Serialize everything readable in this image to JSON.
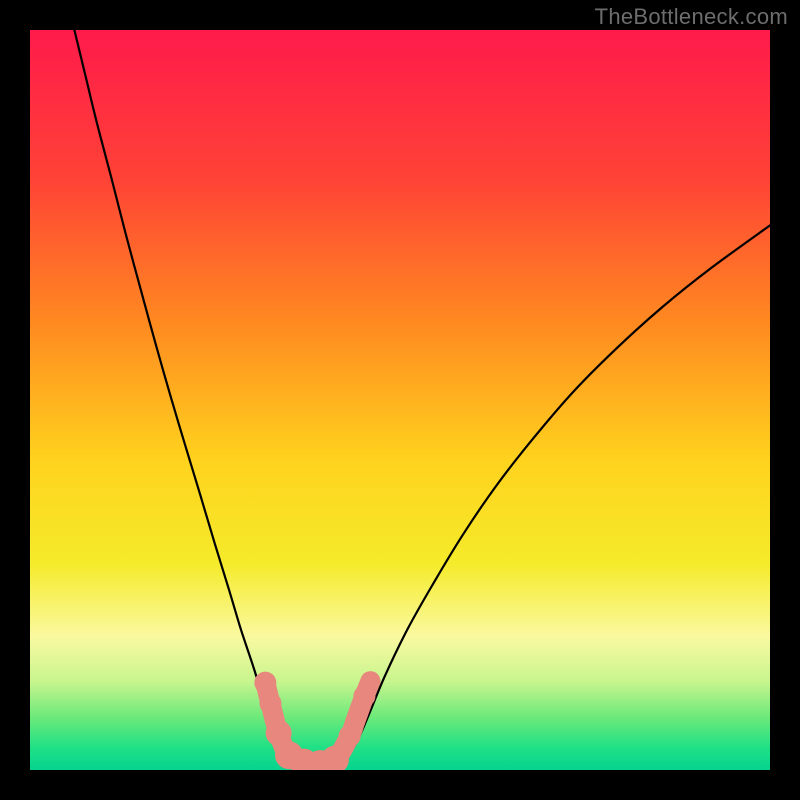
{
  "watermark": "TheBottleneck.com",
  "chart_data": {
    "type": "line",
    "title": "",
    "xlabel": "",
    "ylabel": "",
    "xlim": [
      0,
      1
    ],
    "ylim": [
      0,
      1
    ],
    "background_gradient": {
      "stops": [
        {
          "offset": 0.0,
          "color": "#ff1a4b"
        },
        {
          "offset": 0.2,
          "color": "#ff4236"
        },
        {
          "offset": 0.4,
          "color": "#ff8b20"
        },
        {
          "offset": 0.58,
          "color": "#ffd21e"
        },
        {
          "offset": 0.72,
          "color": "#f5eb2a"
        },
        {
          "offset": 0.82,
          "color": "#faf9a0"
        },
        {
          "offset": 0.88,
          "color": "#c8f58e"
        },
        {
          "offset": 0.93,
          "color": "#6ae97a"
        },
        {
          "offset": 0.97,
          "color": "#1fe086"
        },
        {
          "offset": 1.0,
          "color": "#06d38f"
        }
      ]
    },
    "series": [
      {
        "name": "left-curve",
        "stroke": "#000000",
        "stroke_width": 2.2,
        "points": [
          {
            "x": 0.06,
            "y": 1.0
          },
          {
            "x": 0.075,
            "y": 0.938
          },
          {
            "x": 0.09,
            "y": 0.876
          },
          {
            "x": 0.11,
            "y": 0.8
          },
          {
            "x": 0.13,
            "y": 0.722
          },
          {
            "x": 0.15,
            "y": 0.648
          },
          {
            "x": 0.17,
            "y": 0.575
          },
          {
            "x": 0.19,
            "y": 0.505
          },
          {
            "x": 0.21,
            "y": 0.438
          },
          {
            "x": 0.23,
            "y": 0.372
          },
          {
            "x": 0.25,
            "y": 0.305
          },
          {
            "x": 0.27,
            "y": 0.24
          },
          {
            "x": 0.285,
            "y": 0.19
          },
          {
            "x": 0.3,
            "y": 0.145
          },
          {
            "x": 0.315,
            "y": 0.098
          },
          {
            "x": 0.33,
            "y": 0.055
          },
          {
            "x": 0.345,
            "y": 0.024
          },
          {
            "x": 0.36,
            "y": 0.006
          }
        ]
      },
      {
        "name": "right-curve",
        "stroke": "#000000",
        "stroke_width": 2.2,
        "points": [
          {
            "x": 0.42,
            "y": 0.006
          },
          {
            "x": 0.43,
            "y": 0.018
          },
          {
            "x": 0.445,
            "y": 0.045
          },
          {
            "x": 0.46,
            "y": 0.08
          },
          {
            "x": 0.48,
            "y": 0.128
          },
          {
            "x": 0.51,
            "y": 0.19
          },
          {
            "x": 0.545,
            "y": 0.252
          },
          {
            "x": 0.585,
            "y": 0.318
          },
          {
            "x": 0.63,
            "y": 0.384
          },
          {
            "x": 0.68,
            "y": 0.448
          },
          {
            "x": 0.735,
            "y": 0.512
          },
          {
            "x": 0.795,
            "y": 0.572
          },
          {
            "x": 0.855,
            "y": 0.626
          },
          {
            "x": 0.92,
            "y": 0.678
          },
          {
            "x": 1.0,
            "y": 0.736
          }
        ]
      }
    ],
    "markers": {
      "fill": "#e8877d",
      "stroke": "#c96a60",
      "points": [
        {
          "x": 0.318,
          "y": 0.118,
          "r": 11
        },
        {
          "x": 0.325,
          "y": 0.09,
          "r": 11
        },
        {
          "x": 0.336,
          "y": 0.05,
          "r": 13
        },
        {
          "x": 0.35,
          "y": 0.02,
          "r": 14
        },
        {
          "x": 0.37,
          "y": 0.01,
          "r": 14
        },
        {
          "x": 0.392,
          "y": 0.008,
          "r": 14
        },
        {
          "x": 0.412,
          "y": 0.014,
          "r": 14
        },
        {
          "x": 0.432,
          "y": 0.046,
          "r": 11
        },
        {
          "x": 0.44,
          "y": 0.067,
          "r": 10
        },
        {
          "x": 0.452,
          "y": 0.1,
          "r": 11
        },
        {
          "x": 0.46,
          "y": 0.12,
          "r": 10
        }
      ]
    }
  }
}
